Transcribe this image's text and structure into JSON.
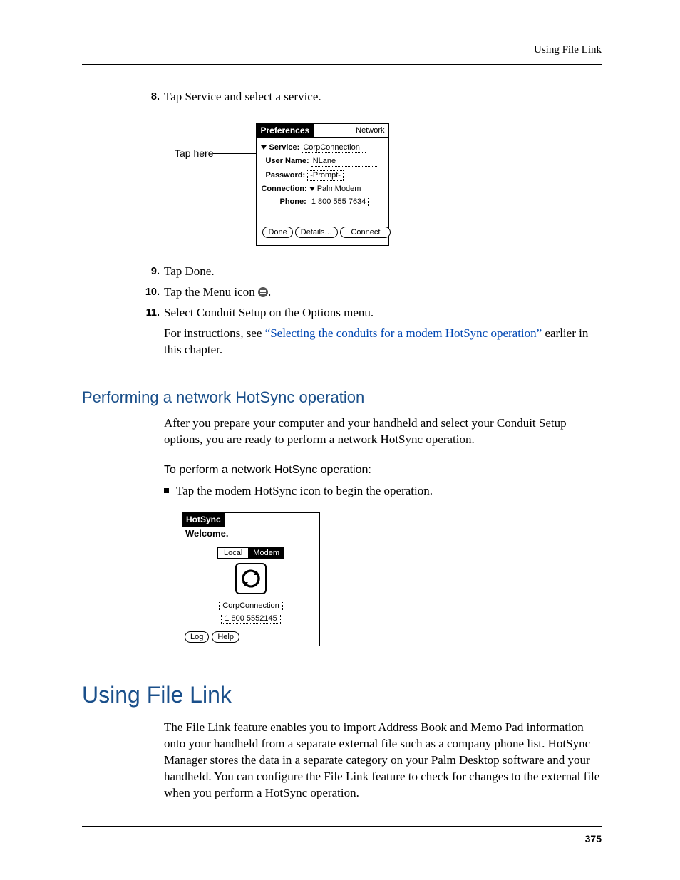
{
  "header": {
    "running": "Using File Link"
  },
  "steps": {
    "s8": {
      "num": "8.",
      "text": "Tap Service and select a service."
    },
    "s9": {
      "num": "9.",
      "text": "Tap Done."
    },
    "s10": {
      "num": "10.",
      "text_a": "Tap the Menu icon ",
      "text_b": "."
    },
    "s11": {
      "num": "11.",
      "line1": "Select Conduit Setup on the Options menu.",
      "para_a": "For instructions, see ",
      "link": "“Selecting the conduits for a modem HotSync operation”",
      "para_b": " earlier in this chapter."
    }
  },
  "fig1": {
    "tap_here": "Tap here",
    "title": "Preferences",
    "category": "Network",
    "service_lbl": "Service:",
    "service_val": "CorpConnection",
    "user_lbl": "User Name:",
    "user_val": "NLane",
    "pass_lbl": "Password:",
    "pass_val": "-Prompt-",
    "conn_lbl": "Connection:",
    "conn_val": "PalmModem",
    "phone_lbl": "Phone:",
    "phone_val": "1 800 555 7634",
    "btn_done": "Done",
    "btn_details": "Details…",
    "btn_connect": "Connect"
  },
  "h2": "Performing a network HotSync operation",
  "para1": "After you prepare your computer and your handheld and select your Conduit Setup options, you are ready to perform a network HotSync operation.",
  "proc": "To perform a network HotSync operation:",
  "bullet": "Tap the modem HotSync icon to begin the operation.",
  "fig2": {
    "title": "HotSync",
    "welcome": "Welcome.",
    "tab_local": "Local",
    "tab_modem": "Modem",
    "conn": "CorpConnection",
    "phone": "1 800 5552145",
    "btn_log": "Log",
    "btn_help": "Help"
  },
  "h1": "Using File Link",
  "para2": "The File Link feature enables you to import Address Book and Memo Pad information onto your handheld from a separate external file such as a company phone list. HotSync Manager stores the data in a separate category on your Palm Desktop software and your handheld. You can configure the File Link feature to check for changes to the external file when you perform a HotSync operation.",
  "page_number": "375"
}
